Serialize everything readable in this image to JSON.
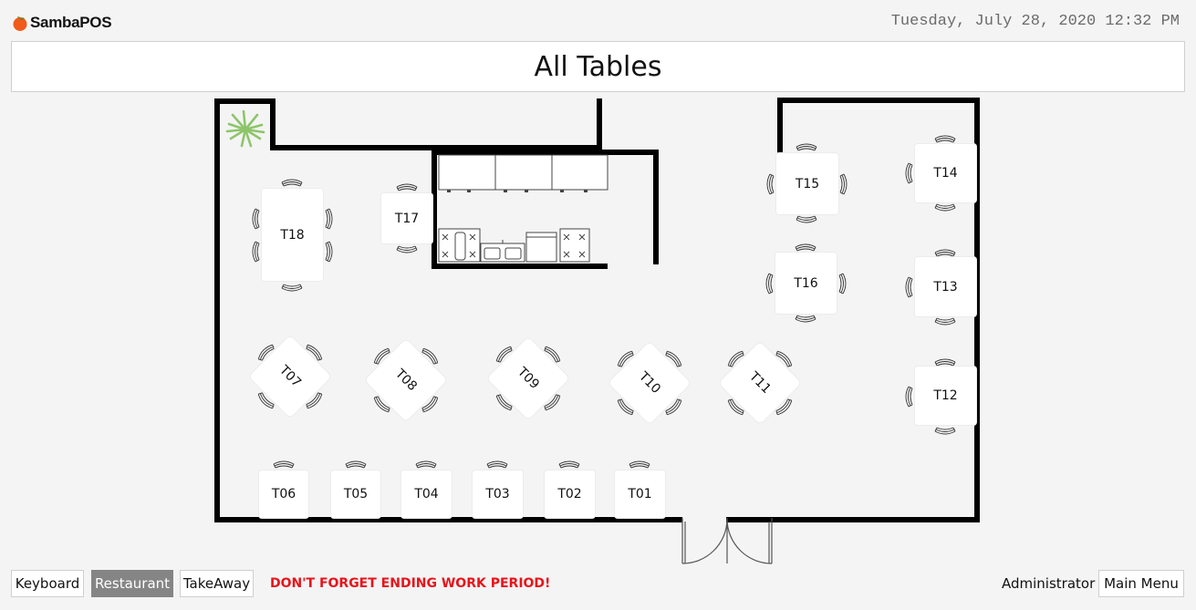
{
  "header": {
    "logo_text": "SambaPOS",
    "datetime": "Tuesday, July 28, 2020 12:32 PM",
    "title": "All Tables"
  },
  "tables": [
    {
      "id": "t01",
      "label": "T01"
    },
    {
      "id": "t02",
      "label": "T02"
    },
    {
      "id": "t03",
      "label": "T03"
    },
    {
      "id": "t04",
      "label": "T04"
    },
    {
      "id": "t05",
      "label": "T05"
    },
    {
      "id": "t06",
      "label": "T06"
    },
    {
      "id": "t07",
      "label": "T07"
    },
    {
      "id": "t08",
      "label": "T08"
    },
    {
      "id": "t09",
      "label": "T09"
    },
    {
      "id": "t10",
      "label": "T10"
    },
    {
      "id": "t11",
      "label": "T11"
    },
    {
      "id": "t12",
      "label": "T12"
    },
    {
      "id": "t13",
      "label": "T13"
    },
    {
      "id": "t14",
      "label": "T14"
    },
    {
      "id": "t15",
      "label": "T15"
    },
    {
      "id": "t16",
      "label": "T16"
    },
    {
      "id": "t17",
      "label": "T17"
    },
    {
      "id": "t18",
      "label": "T18"
    }
  ],
  "footer": {
    "keyboard": "Keyboard",
    "restaurant": "Restaurant",
    "takeaway": "TakeAway",
    "warning": "DON'T FORGET ENDING WORK PERIOD!",
    "user": "Administrator",
    "main_menu": "Main Menu"
  },
  "colors": {
    "warning": "#e8141b",
    "active_tab": "#858585",
    "plant": "#8dc56a",
    "logo_orange": "#f05a1a"
  }
}
